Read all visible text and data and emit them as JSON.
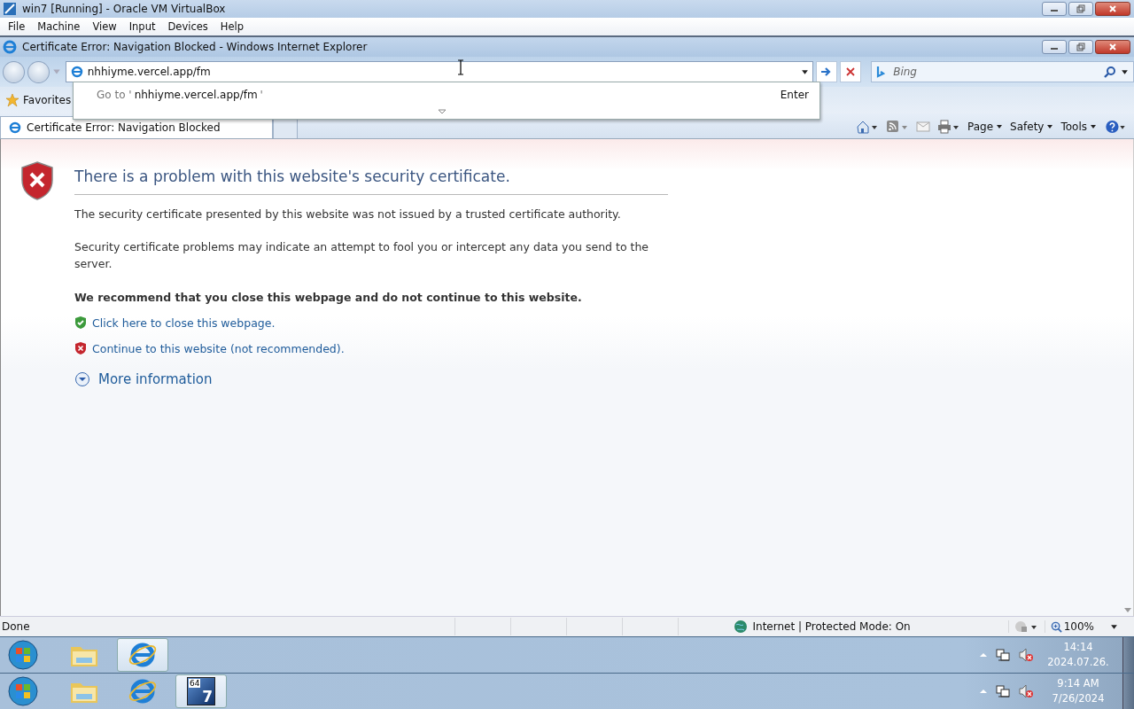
{
  "vm_window": {
    "title": "win7 [Running] - Oracle VM VirtualBox",
    "menu": [
      "File",
      "Machine",
      "View",
      "Input",
      "Devices",
      "Help"
    ]
  },
  "ie_window": {
    "title": "Certificate Error: Navigation Blocked - Windows Internet Explorer"
  },
  "address_bar": {
    "value": "nhhiyme.vercel.app/fm"
  },
  "address_suggestion": {
    "prefix": "Go to '",
    "url": "nhhiyme.vercel.app/fm",
    "suffix": "'",
    "hint": "Enter"
  },
  "search": {
    "placeholder": "Bing"
  },
  "favorites": {
    "label": "Favorites"
  },
  "tabs": [
    {
      "label": "Certificate Error: Navigation Blocked",
      "selected": true
    }
  ],
  "command_bar": [
    "Page",
    "Safety",
    "Tools"
  ],
  "page": {
    "heading": "There is a problem with this website's security certificate.",
    "paragraphs": [
      "The security certificate presented by this website was not issued by a trusted certificate authority.",
      "Security certificate problems may indicate an attempt to fool you or intercept any data you send to the server."
    ],
    "recommendation": "We recommend that you close this webpage and do not continue to this website.",
    "links": [
      {
        "kind": "safe",
        "label": "Click here to close this webpage."
      },
      {
        "kind": "danger",
        "label": "Continue to this website (not recommended)."
      }
    ],
    "more_info": "More information"
  },
  "status_bar": {
    "text": "Done",
    "zone": "Internet | Protected Mode: On",
    "zoom": "100%"
  },
  "taskbars": [
    {
      "time": "14:14",
      "date": "2024.07.26.",
      "apps": [
        {
          "kind": "folder",
          "selected": false
        },
        {
          "kind": "ie",
          "selected": true
        }
      ]
    },
    {
      "time": "9:14 AM",
      "date": "7/26/2024",
      "apps": [
        {
          "kind": "folder",
          "selected": false
        },
        {
          "kind": "ie",
          "selected": false
        },
        {
          "kind": "vm",
          "selected": true,
          "badge": "64",
          "digit": "7"
        }
      ]
    }
  ]
}
